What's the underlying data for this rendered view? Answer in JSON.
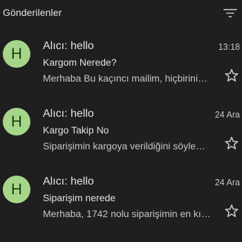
{
  "header": {
    "title": "Gönderilenler"
  },
  "icons": {
    "filter": "filter-icon",
    "star": "star-icon"
  },
  "colors": {
    "background": "#1f1f1f",
    "avatar_bg": "#a6d68a",
    "avatar_text": "#1f3b12"
  },
  "mails": [
    {
      "avatar_letter": "H",
      "sender": "Alıcı: hello",
      "date": "13:18",
      "subject": "Kargom Nerede?",
      "snippet": "Merhaba Bu kaçıncı mailim, hiçbirini…"
    },
    {
      "avatar_letter": "H",
      "sender": "Alıcı: hello",
      "date": "24 Ara",
      "subject": "Kargo Takip No",
      "snippet": "Siparişimin kargoya verildiğini söyle…"
    },
    {
      "avatar_letter": "H",
      "sender": "Alıcı: hello",
      "date": "24 Ara",
      "subject": "Siparişim nerede",
      "snippet": "Merhaba, 1742 nolu siparişimin en kı…"
    }
  ]
}
